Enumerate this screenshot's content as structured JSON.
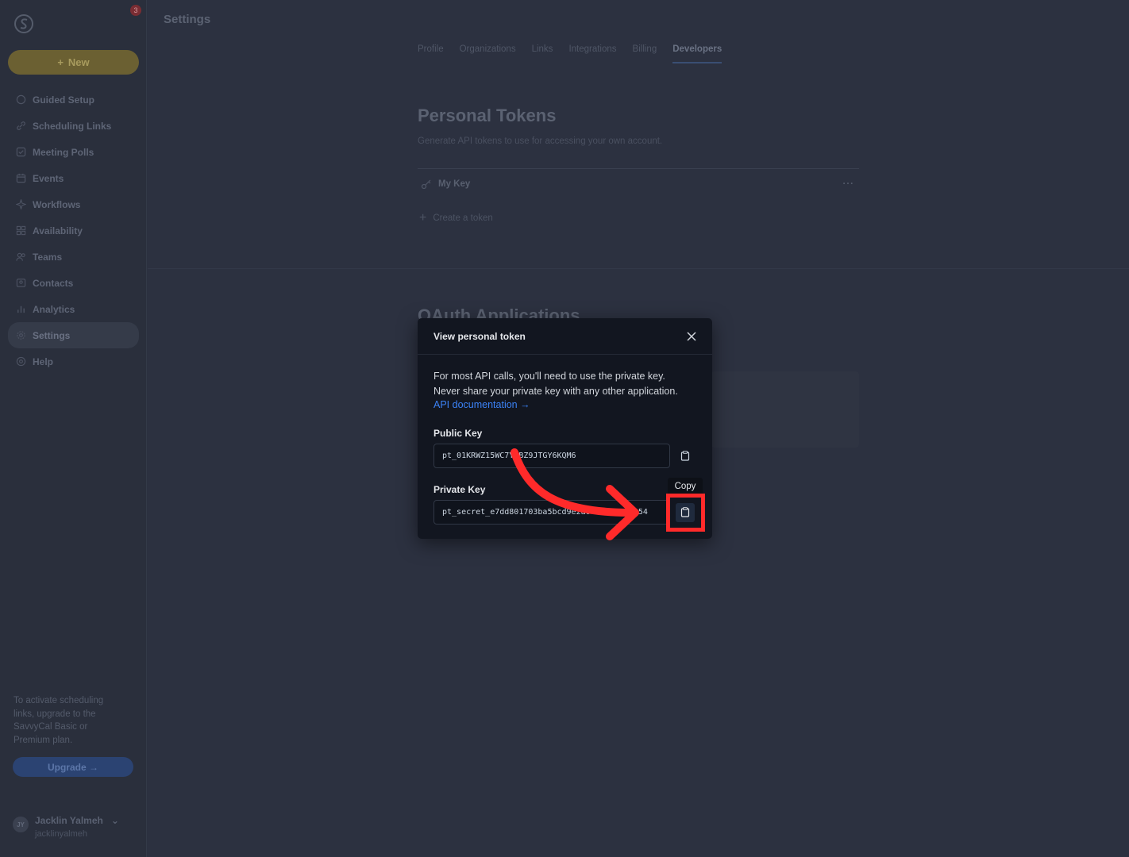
{
  "sidebar": {
    "notification_count": "3",
    "new_button": "New",
    "items": [
      {
        "label": "Guided Setup",
        "icon": "circle-icon"
      },
      {
        "label": "Scheduling Links",
        "icon": "link-icon"
      },
      {
        "label": "Meeting Polls",
        "icon": "poll-icon"
      },
      {
        "label": "Events",
        "icon": "calendar-icon"
      },
      {
        "label": "Workflows",
        "icon": "workflow-icon"
      },
      {
        "label": "Availability",
        "icon": "grid-icon"
      },
      {
        "label": "Teams",
        "icon": "users-icon"
      },
      {
        "label": "Contacts",
        "icon": "contacts-icon"
      },
      {
        "label": "Analytics",
        "icon": "bar-chart-icon"
      },
      {
        "label": "Settings",
        "icon": "gear-icon"
      },
      {
        "label": "Help",
        "icon": "help-icon"
      }
    ],
    "upgrade_text": "To activate scheduling links, upgrade to the SavvyCal Basic or Premium plan.",
    "upgrade_button": "Upgrade →",
    "user": {
      "initials": "JY",
      "name": "Jacklin Yalmeh",
      "handle": "jacklinyalmeh"
    }
  },
  "header": {
    "title": "Settings"
  },
  "tabs": [
    "Profile",
    "Organizations",
    "Links",
    "Integrations",
    "Billing",
    "Developers"
  ],
  "active_tab": "Developers",
  "personal_tokens": {
    "title": "Personal Tokens",
    "subtitle": "Generate API tokens to use for accessing your own account.",
    "token_name": "My Key",
    "more": "···",
    "create_label": "Create a token"
  },
  "oauth": {
    "title": "OAuth Applications"
  },
  "modal": {
    "title": "View personal token",
    "description_line1": "For most API calls, you'll need to use the private key.",
    "description_line2": "Never share your private key with any other application.",
    "api_link": "API documentation →",
    "public_key_label": "Public Key",
    "public_key_value": "pt_01KRWZ15WC7YRBZ9JTGY6KQM6",
    "private_key_label": "Private Key",
    "private_key_value": "pt_secret_e7dd801703ba5bcd9e2a0c4f1b8e7f254",
    "copy_tooltip": "Copy"
  },
  "colors": {
    "accent_blue": "#3b82f6",
    "highlight_red": "#ff2a2a"
  }
}
